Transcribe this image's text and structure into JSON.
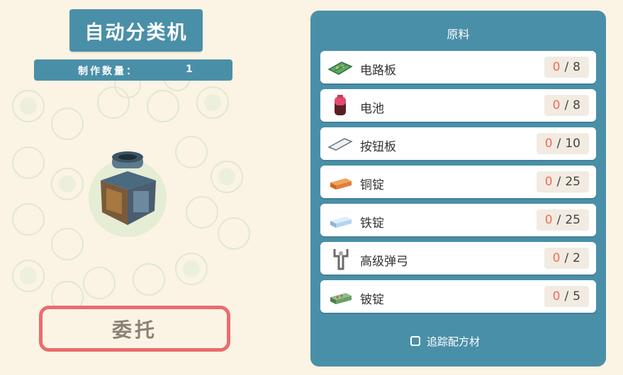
{
  "machine": {
    "title": "自动分类机",
    "qty_label": "制作数量：",
    "qty_value": "1"
  },
  "actions": {
    "commission_label": "委托"
  },
  "materials_panel": {
    "title": "原料",
    "items": [
      {
        "name": "电路板",
        "icon": "circuit-board-icon",
        "have": "0",
        "need": "8"
      },
      {
        "name": "电池",
        "icon": "battery-icon",
        "have": "0",
        "need": "8"
      },
      {
        "name": "按钮板",
        "icon": "button-board-icon",
        "have": "0",
        "need": "10"
      },
      {
        "name": "铜锭",
        "icon": "copper-ingot-icon",
        "have": "0",
        "need": "25"
      },
      {
        "name": "铁锭",
        "icon": "iron-ingot-icon",
        "have": "0",
        "need": "25"
      },
      {
        "name": "高级弹弓",
        "icon": "slingshot-icon",
        "have": "0",
        "need": "2"
      },
      {
        "name": "铍锭",
        "icon": "beryllium-ingot-icon",
        "have": "0",
        "need": "5"
      }
    ],
    "separator": "/",
    "track_label": "追踪配方材"
  },
  "colors": {
    "panel_blue": "#4a8fa8",
    "background": "#fbf3e3",
    "button_border": "#ec6b6d",
    "have_count": "#ef6d57"
  }
}
